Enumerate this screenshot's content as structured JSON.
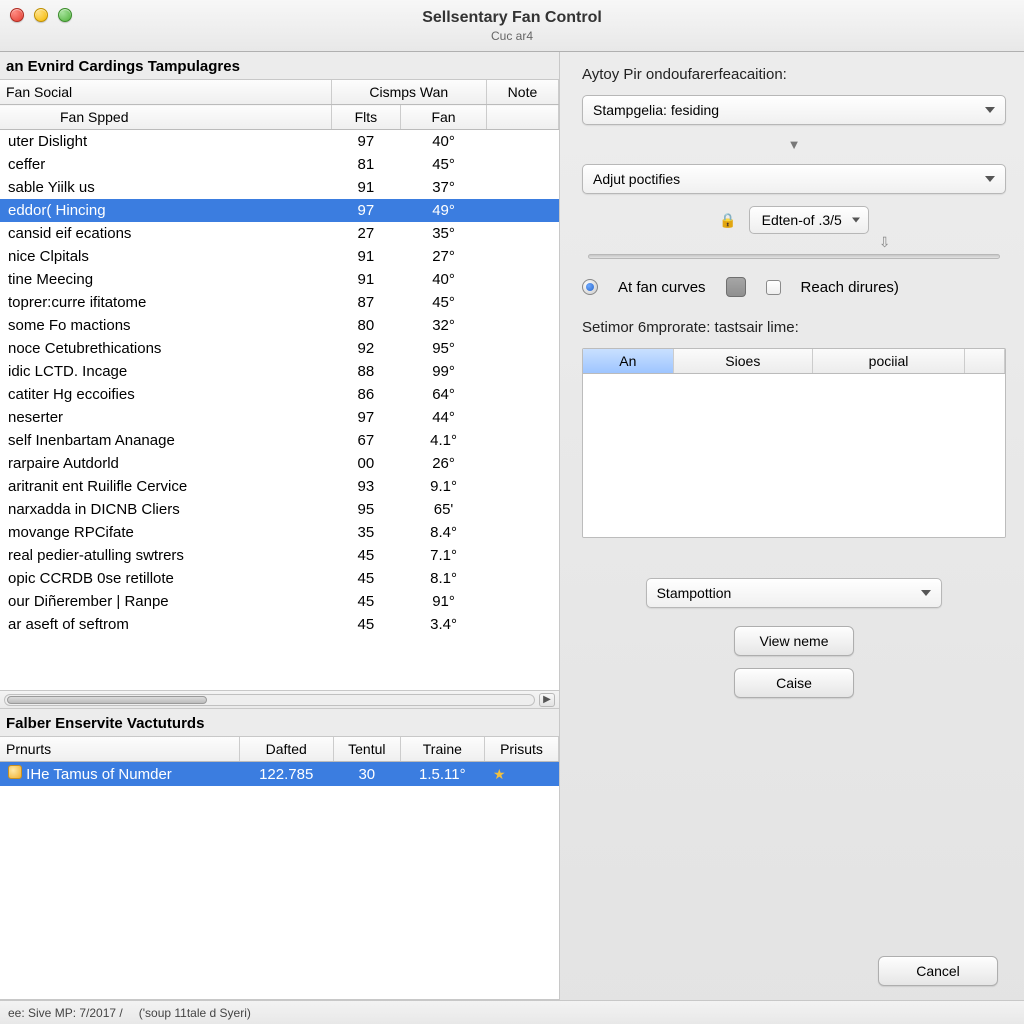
{
  "window": {
    "title": "Sellsentary Fan Control",
    "subtitle": "Cuc ar4"
  },
  "main_table": {
    "section_header": "an Evnird Cardings Tampulagres",
    "group_headers": {
      "a": "Fan Social",
      "b": "Cismps Wan",
      "c": "Note"
    },
    "headers": {
      "name": "Fan Spped",
      "fits": "Flts",
      "fan": "Fan"
    },
    "rows": [
      {
        "name": "uter Dislight",
        "fits": "97",
        "fan": "40°"
      },
      {
        "name": "ceffer",
        "fits": "81",
        "fan": "45°"
      },
      {
        "name": "sable Yiilk us",
        "fits": "91",
        "fan": "37°"
      },
      {
        "name": "eddor( Hincing",
        "fits": "97",
        "fan": "49°",
        "selected": true
      },
      {
        "name": "cansid eif ecations",
        "fits": "27",
        "fan": "35°"
      },
      {
        "name": "nice Clpitals",
        "fits": "91",
        "fan": "27°"
      },
      {
        "name": "tine Meecing",
        "fits": "91",
        "fan": "40°"
      },
      {
        "name": "toprer:curre ifitatome",
        "fits": "87",
        "fan": "45°"
      },
      {
        "name": "some Fo mactions",
        "fits": "80",
        "fan": "32°"
      },
      {
        "name": "noce Cetubrethications",
        "fits": "92",
        "fan": "95°"
      },
      {
        "name": "idic LCTD. Incage",
        "fits": "88",
        "fan": "99°"
      },
      {
        "name": "catiter Hg eccoifies",
        "fits": "86",
        "fan": "64°"
      },
      {
        "name": "neserter",
        "fits": "97",
        "fan": "44°"
      },
      {
        "name": "self Inenbartam Ananage",
        "fits": "67",
        "fan": "4.1°"
      },
      {
        "name": "rarpaire Autdorld",
        "fits": "00",
        "fan": "26°"
      },
      {
        "name": "aritranit ent Ruilifle Cervice",
        "fits": "93",
        "fan": "9.1°"
      },
      {
        "name": "narxadda in DICNB Cliers",
        "fits": "95",
        "fan": "65'"
      },
      {
        "name": "movange RPCifate",
        "fits": "35",
        "fan": "8.4°"
      },
      {
        "name": "real pedier-atulling swtrers",
        "fits": "45",
        "fan": "7.1°"
      },
      {
        "name": "opic CCRDB 0se retillote",
        "fits": "45",
        "fan": "8.1°"
      },
      {
        "name": "our Diñerember | Ranpe",
        "fits": "45",
        "fan": "91°"
      },
      {
        "name": "ar aseft of seftrom",
        "fits": "45",
        "fan": "3.4°"
      }
    ]
  },
  "bottom_table": {
    "section_header": "Falber Enservite Vactuturds",
    "headers": {
      "a": "Prnurts",
      "b": "Dafted",
      "c": "Tentul",
      "d": "Traine",
      "e": "Prisuts"
    },
    "rows": [
      {
        "a": "IHe Tamus of Numder",
        "b": "122.785",
        "c": "30",
        "d": "1.5.11°",
        "e": "",
        "selected": true
      }
    ]
  },
  "panel": {
    "label": "Aytoy Pir ondoufarerfeacaition:",
    "select1": "Stampgelia: fesiding",
    "select2": "Adjut poctifies",
    "mini_select": "Edten-of .3/5",
    "radio1": "At fan curves",
    "radio2": "Reach dirures)",
    "label2": "Setimor 6mprorate: tastsair lime:",
    "mini_headers": {
      "a": "An",
      "b": "Sioes",
      "c": "pociial"
    },
    "select3": "Stampottion",
    "btn_view": "View neme",
    "btn_caise": "Caise",
    "btn_cancel": "Cancel"
  },
  "status": {
    "a": "ee: Sive MP: 7/2017 /",
    "b": "('soup 11tale d Syeri)"
  }
}
